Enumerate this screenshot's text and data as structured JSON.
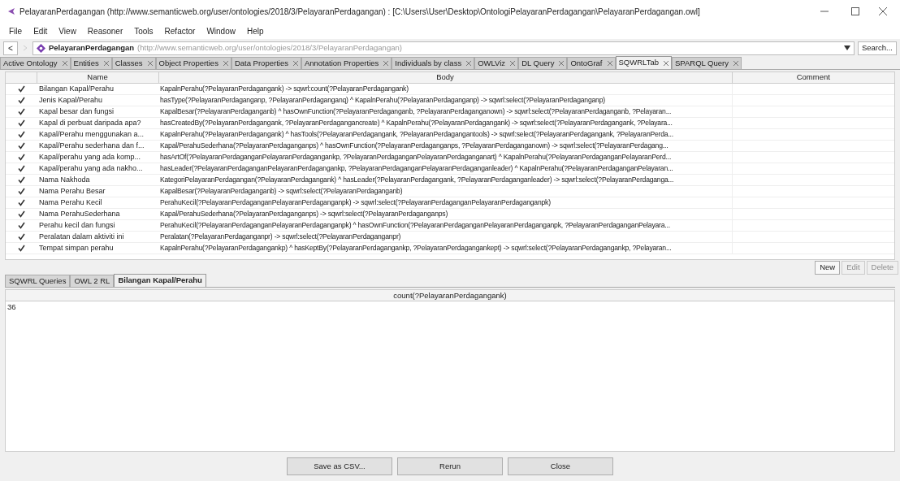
{
  "window": {
    "title": "PelayaranPerdagangan (http://www.semanticweb.org/user/ontologies/2018/3/PelayaranPerdagangan) : [C:\\Users\\User\\Desktop\\OntologiPelayaranPerdagangan\\PelayaranPerdagangan.owl]"
  },
  "menu": [
    "File",
    "Edit",
    "View",
    "Reasoner",
    "Tools",
    "Refactor",
    "Window",
    "Help"
  ],
  "address_bar": {
    "back": "<",
    "name": "PelayaranPerdagangan",
    "iri": "(http://www.semanticweb.org/user/ontologies/2018/3/PelayaranPerdagangan)",
    "search": "Search..."
  },
  "tabs": [
    {
      "label": "Active Ontology",
      "selected": false
    },
    {
      "label": "Entities",
      "selected": false
    },
    {
      "label": "Classes",
      "selected": false
    },
    {
      "label": "Object Properties",
      "selected": false
    },
    {
      "label": "Data Properties",
      "selected": false
    },
    {
      "label": "Annotation Properties",
      "selected": false
    },
    {
      "label": "Individuals by class",
      "selected": false
    },
    {
      "label": "OWLViz",
      "selected": false
    },
    {
      "label": "DL Query",
      "selected": false
    },
    {
      "label": "OntoGraf",
      "selected": false
    },
    {
      "label": "SQWRLTab",
      "selected": true
    },
    {
      "label": "SPARQL Query",
      "selected": false
    }
  ],
  "rules_table": {
    "columns": [
      "Name",
      "Body",
      "Comment"
    ],
    "rows": [
      {
        "checked": true,
        "name": "Bilangan Kapal/Perahu",
        "body": "KapalnPerahu(?PelayaranPerdagangank) -> sqwrl:count(?PelayaranPerdagangank)"
      },
      {
        "checked": true,
        "name": "Jenis Kapal/Perahu",
        "body": "hasType(?PelayaranPerdaganganp, ?PelayaranPerdaganganq) ^ KapalnPerahu(?PelayaranPerdaganganp) -> sqwrl:select(?PelayaranPerdaganganp)"
      },
      {
        "checked": true,
        "name": "Kapal besar dan fungsi",
        "body": "KapalBesar(?PelayaranPerdaganganb) ^ hasOwnFunction(?PelayaranPerdaganganb, ?PelayaranPerdaganganown) -> sqwrl:select(?PelayaranPerdaganganb, ?Pelayaran..."
      },
      {
        "checked": true,
        "name": "Kapal di perbuat daripada apa?",
        "body": "hasCreatedBy(?PelayaranPerdagangank, ?PelayaranPerdagangancreate) ^ KapalnPerahu(?PelayaranPerdagangank) -> sqwrl:select(?PelayaranPerdagangank, ?Pelayara..."
      },
      {
        "checked": true,
        "name": "Kapal/Perahu menggunakan a...",
        "body": "KapalnPerahu(?PelayaranPerdagangank) ^ hasTools(?PelayaranPerdagangank, ?PelayaranPerdagangantools) -> sqwrl:select(?PelayaranPerdagangank, ?PelayaranPerda..."
      },
      {
        "checked": true,
        "name": "Kapal/Perahu sederhana dan f...",
        "body": "Kapal/PerahuSederhana(?PelayaranPerdaganganps) ^ hasOwnFunction(?PelayaranPerdaganganps, ?PelayaranPerdaganganown) -> sqwrl:select(?PelayaranPerdagang..."
      },
      {
        "checked": true,
        "name": "Kapal/perahu yang ada komp...",
        "body": "hasArtOf(?PelayaranPerdaganganPelayaranPerdagangankp, ?PelayaranPerdaganganPelayaranPerdaganganart) ^ KapalnPerahu(?PelayaranPerdaganganPelayaranPerd..."
      },
      {
        "checked": true,
        "name": "Kapal/perahu yang ada nakho...",
        "body": "hasLeader(?PelayaranPerdaganganPelayaranPerdagangankp, ?PelayaranPerdaganganPelayaranPerdaganganleader) ^ KapalnPerahu(?PelayaranPerdaganganPelayaran..."
      },
      {
        "checked": true,
        "name": "Nama Nakhoda",
        "body": "KategoriPelayaranPerdagangan(?PelayaranPerdagangank) ^ hasLeader(?PelayaranPerdagangank, ?PelayaranPerdaganganleader) -> sqwrl:select(?PelayaranPerdaganga..."
      },
      {
        "checked": true,
        "name": "Nama Perahu Besar",
        "body": "KapalBesar(?PelayaranPerdaganganb) -> sqwrl:select(?PelayaranPerdaganganb)"
      },
      {
        "checked": true,
        "name": "Nama Perahu Kecil",
        "body": "PerahuKecil(?PelayaranPerdaganganPelayaranPerdaganganpk) -> sqwrl:select(?PelayaranPerdaganganPelayaranPerdaganganpk)"
      },
      {
        "checked": true,
        "name": "Nama PerahuSederhana",
        "body": "Kapal/PerahuSederhana(?PelayaranPerdaganganps) -> sqwrl:select(?PelayaranPerdaganganps)"
      },
      {
        "checked": true,
        "name": "Perahu kecil dan fungsi",
        "body": "PerahuKecil(?PelayaranPerdaganganPelayaranPerdaganganpk) ^ hasOwnFunction(?PelayaranPerdaganganPelayaranPerdaganganpk, ?PelayaranPerdaganganPelayara..."
      },
      {
        "checked": true,
        "name": "Peralatan dalam aktiviti ini",
        "body": "Peralatan(?PelayaranPerdaganganpr) -> sqwrl:select(?PelayaranPerdaganganpr)"
      },
      {
        "checked": true,
        "name": "Tempat simpan perahu",
        "body": "KapalnPerahu(?PelayaranPerdagangankp) ^ hasKeptBy(?PelayaranPerdagangankp, ?PelayaranPerdagangankept) -> sqwrl:select(?PelayaranPerdagangankp, ?Pelayaran..."
      }
    ]
  },
  "rule_buttons": [
    {
      "label": "New",
      "disabled": false
    },
    {
      "label": "Edit",
      "disabled": true
    },
    {
      "label": "Delete",
      "disabled": true
    }
  ],
  "result_tabs": [
    {
      "label": "SQWRL Queries",
      "selected": false
    },
    {
      "label": "OWL 2 RL",
      "selected": false
    },
    {
      "label": "Bilangan Kapal/Perahu",
      "selected": true
    }
  ],
  "result_table": {
    "columns": [
      "count(?PelayaranPerdagangank)"
    ],
    "rows": [
      [
        "36"
      ]
    ]
  },
  "buttons": [
    "Save as CSV...",
    "Rerun",
    "Close"
  ]
}
